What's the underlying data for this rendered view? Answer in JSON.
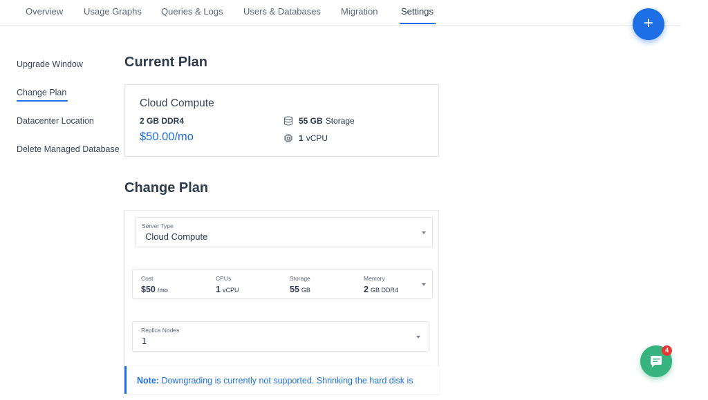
{
  "tabs": [
    {
      "label": "Overview"
    },
    {
      "label": "Usage Graphs"
    },
    {
      "label": "Queries & Logs"
    },
    {
      "label": "Users & Databases"
    },
    {
      "label": "Migration"
    },
    {
      "label": "Settings",
      "active": true
    }
  ],
  "fab": {
    "label": "+"
  },
  "sidenav": [
    {
      "label": "Upgrade Window"
    },
    {
      "label": "Change Plan",
      "active": true
    },
    {
      "label": "Datacenter Location"
    },
    {
      "label": "Delete Managed Database"
    }
  ],
  "current_plan": {
    "heading": "Current Plan",
    "name": "Cloud Compute",
    "memory": "2 GB DDR4",
    "price": "$50.00/mo",
    "storage_value": "55 GB",
    "storage_label": "Storage",
    "cpu_value": "1",
    "cpu_label": "vCPU"
  },
  "change_plan": {
    "heading": "Change Plan",
    "server_type": {
      "label": "Server Type",
      "value": "Cloud Compute"
    },
    "plan_selector": {
      "cost": {
        "label": "Cost",
        "value": "$50",
        "unit": "/mo"
      },
      "cpus": {
        "label": "CPUs",
        "value": "1",
        "unit": "vCPU"
      },
      "storage": {
        "label": "Storage",
        "value": "55",
        "unit": "GB"
      },
      "memory": {
        "label": "Memory",
        "value": "2",
        "unit": "GB DDR4"
      }
    },
    "replica_nodes": {
      "label": "Replica Nodes",
      "value": "1"
    }
  },
  "note": {
    "prefix": "Note:",
    "text": "Downgrading is currently not supported. Shrinking the hard disk is"
  },
  "chat": {
    "badge_count": "4"
  },
  "colors": {
    "accent": "#1e6fe5",
    "chat": "#36b37e",
    "badge": "#e53935"
  }
}
